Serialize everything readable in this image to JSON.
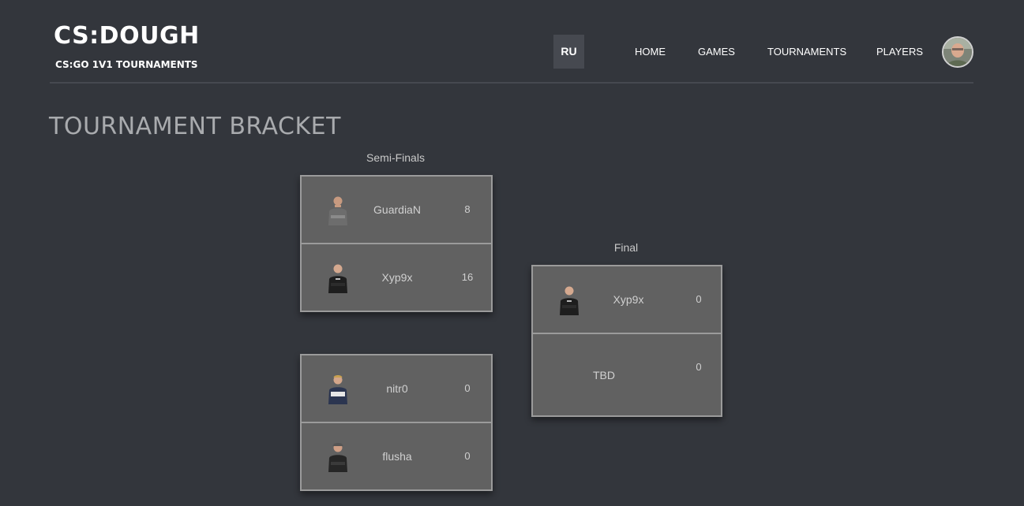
{
  "header": {
    "logo_title": "CS:DOUGH",
    "logo_subtitle": "CS:GO 1V1 TOURNAMENTS",
    "lang_button": "RU",
    "nav": [
      "HOME",
      "GAMES",
      "TOURNAMENTS",
      "PLAYERS"
    ]
  },
  "page_title": "TOURNAMENT BRACKET",
  "rounds": {
    "semi_finals": {
      "label": "Semi-Finals",
      "matches": [
        {
          "players": [
            {
              "name": "GuardiaN",
              "score": "8"
            },
            {
              "name": "Xyp9x",
              "score": "16"
            }
          ]
        },
        {
          "players": [
            {
              "name": "nitr0",
              "score": "0"
            },
            {
              "name": "flusha",
              "score": "0"
            }
          ]
        }
      ]
    },
    "final": {
      "label": "Final",
      "matches": [
        {
          "players": [
            {
              "name": "Xyp9x",
              "score": "0"
            },
            {
              "name": "TBD",
              "score": "0"
            }
          ]
        }
      ]
    }
  },
  "colors": {
    "background": "#33363c",
    "slot": "#616161",
    "border": "#9b9b9b"
  }
}
